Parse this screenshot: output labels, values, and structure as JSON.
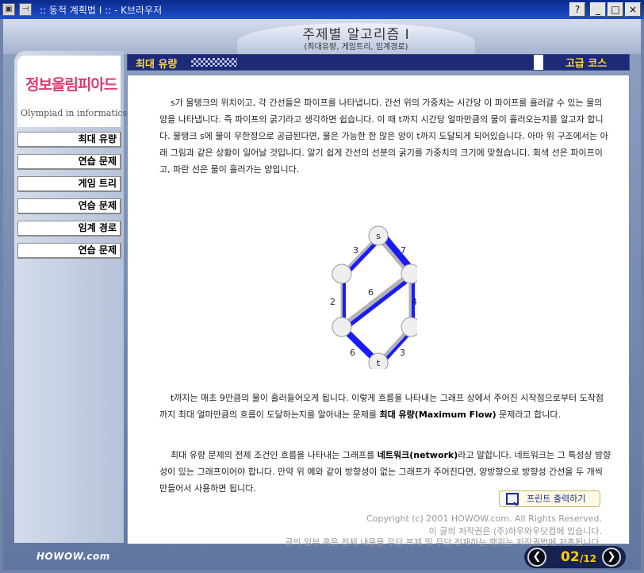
{
  "window": {
    "title": ":: 동적 계획법 I :: - K브라우저",
    "buttons": [
      "?",
      "_",
      "□",
      "×"
    ]
  },
  "header": {
    "title": "주제별 알고리즘 I",
    "subtitle": "(최대유량, 게임트리, 임계경로)"
  },
  "logo": {
    "text": "정보올림피아드",
    "subtext": "Olympiad in informatics"
  },
  "sidebar": {
    "items": [
      {
        "label": "최대 유량"
      },
      {
        "label": "연습 문제"
      },
      {
        "label": "게임 트리"
      },
      {
        "label": "연습 문제"
      },
      {
        "label": "임계 경로"
      },
      {
        "label": "연습 문제"
      }
    ]
  },
  "section": {
    "title": "최대 유량",
    "course": "고급 코스"
  },
  "content": {
    "para1": "s가 물탱크의 위치이고, 각 간선들은 파이프를 나타냅니다. 간선 위의 가중치는 시간당 이 파이프를 흘러갈 수 있는 물의 양을 나타냅니다. 즉 파이프의 굵기라고 생각하면 쉽습니다. 이 때 t까지 시간당 얼마만큼의 물이 흘러오는지를 알고자 합니다. 물탱크 s에 물이 무한정으로 공급된다면, 물은 가능한 한 많은 양이 t까지 도달되게 되어있습니다. 아마 위 구조에서는 아래 그림과 같은 상황이 일어날 것입니다. 알기 쉽게 간선의 선분의 굵기를 가중치의 크기에 맞췄습니다. 회색 선은 파이프이고, 파란 선은 물이 흘러가는 양입니다.",
    "para2_pre": "t까지는 매초 9만큼의 물이 흘러들어오게 됩니다. 이렇게 흐름을 나타내는 그래프 상에서 주어진 시작점으로부터 도착점까지 최대 얼마만큼의 흐름이 도달하는지를 알아내는 문제를 ",
    "para2_bold": "최대 유량(Maximum Flow)",
    "para2_post": " 문제라고 합니다.",
    "para3_pre": "최대 유량 문제의 전제 조건인 흐름을 나타내는 그래프를 ",
    "para3_bold": "네트워크(network)",
    "para3_post": "라고 말합니다. 네트워크는 그 특성상 방향성이 있는 그래프이어야 합니다. 만약 위 예와 같이 방향성이 없는 그래프가 주어진다면, 양방향으로 방향성 간선을 두 개씩 만들어서 사용하면 됩니다.",
    "print_label": "프린트 출력하기",
    "copyright1": "Copyright (c) 2001 HOWOW.com. All Rights Reserved.",
    "copyright2": "이 글의 저작권은 (주)하우와우닷컴에 있습니다.",
    "copyright3": "글의 일부 혹은 전체 내용을 무단 복제 및 무단 전재하는 행위는 저작권법에 저촉됩니다."
  },
  "graph": {
    "nodes": [
      {
        "id": "s",
        "label": "s"
      },
      {
        "id": "a",
        "label": ""
      },
      {
        "id": "b",
        "label": ""
      },
      {
        "id": "c",
        "label": ""
      },
      {
        "id": "d",
        "label": ""
      },
      {
        "id": "t",
        "label": "t"
      }
    ],
    "edges": [
      {
        "from": "s",
        "to": "a",
        "weight": "3"
      },
      {
        "from": "s",
        "to": "b",
        "weight": "7"
      },
      {
        "from": "a",
        "to": "c",
        "weight": "2"
      },
      {
        "from": "b",
        "to": "c",
        "weight": "6"
      },
      {
        "from": "b",
        "to": "d",
        "weight": "4"
      },
      {
        "from": "c",
        "to": "t",
        "weight": "6"
      },
      {
        "from": "d",
        "to": "t",
        "weight": "3"
      }
    ],
    "colors": {
      "pipe": "#b3b3b3",
      "flow": "#1a1aff"
    }
  },
  "footer": {
    "brand": "HOWOW.com",
    "page_current": "02",
    "page_total": "/12"
  }
}
